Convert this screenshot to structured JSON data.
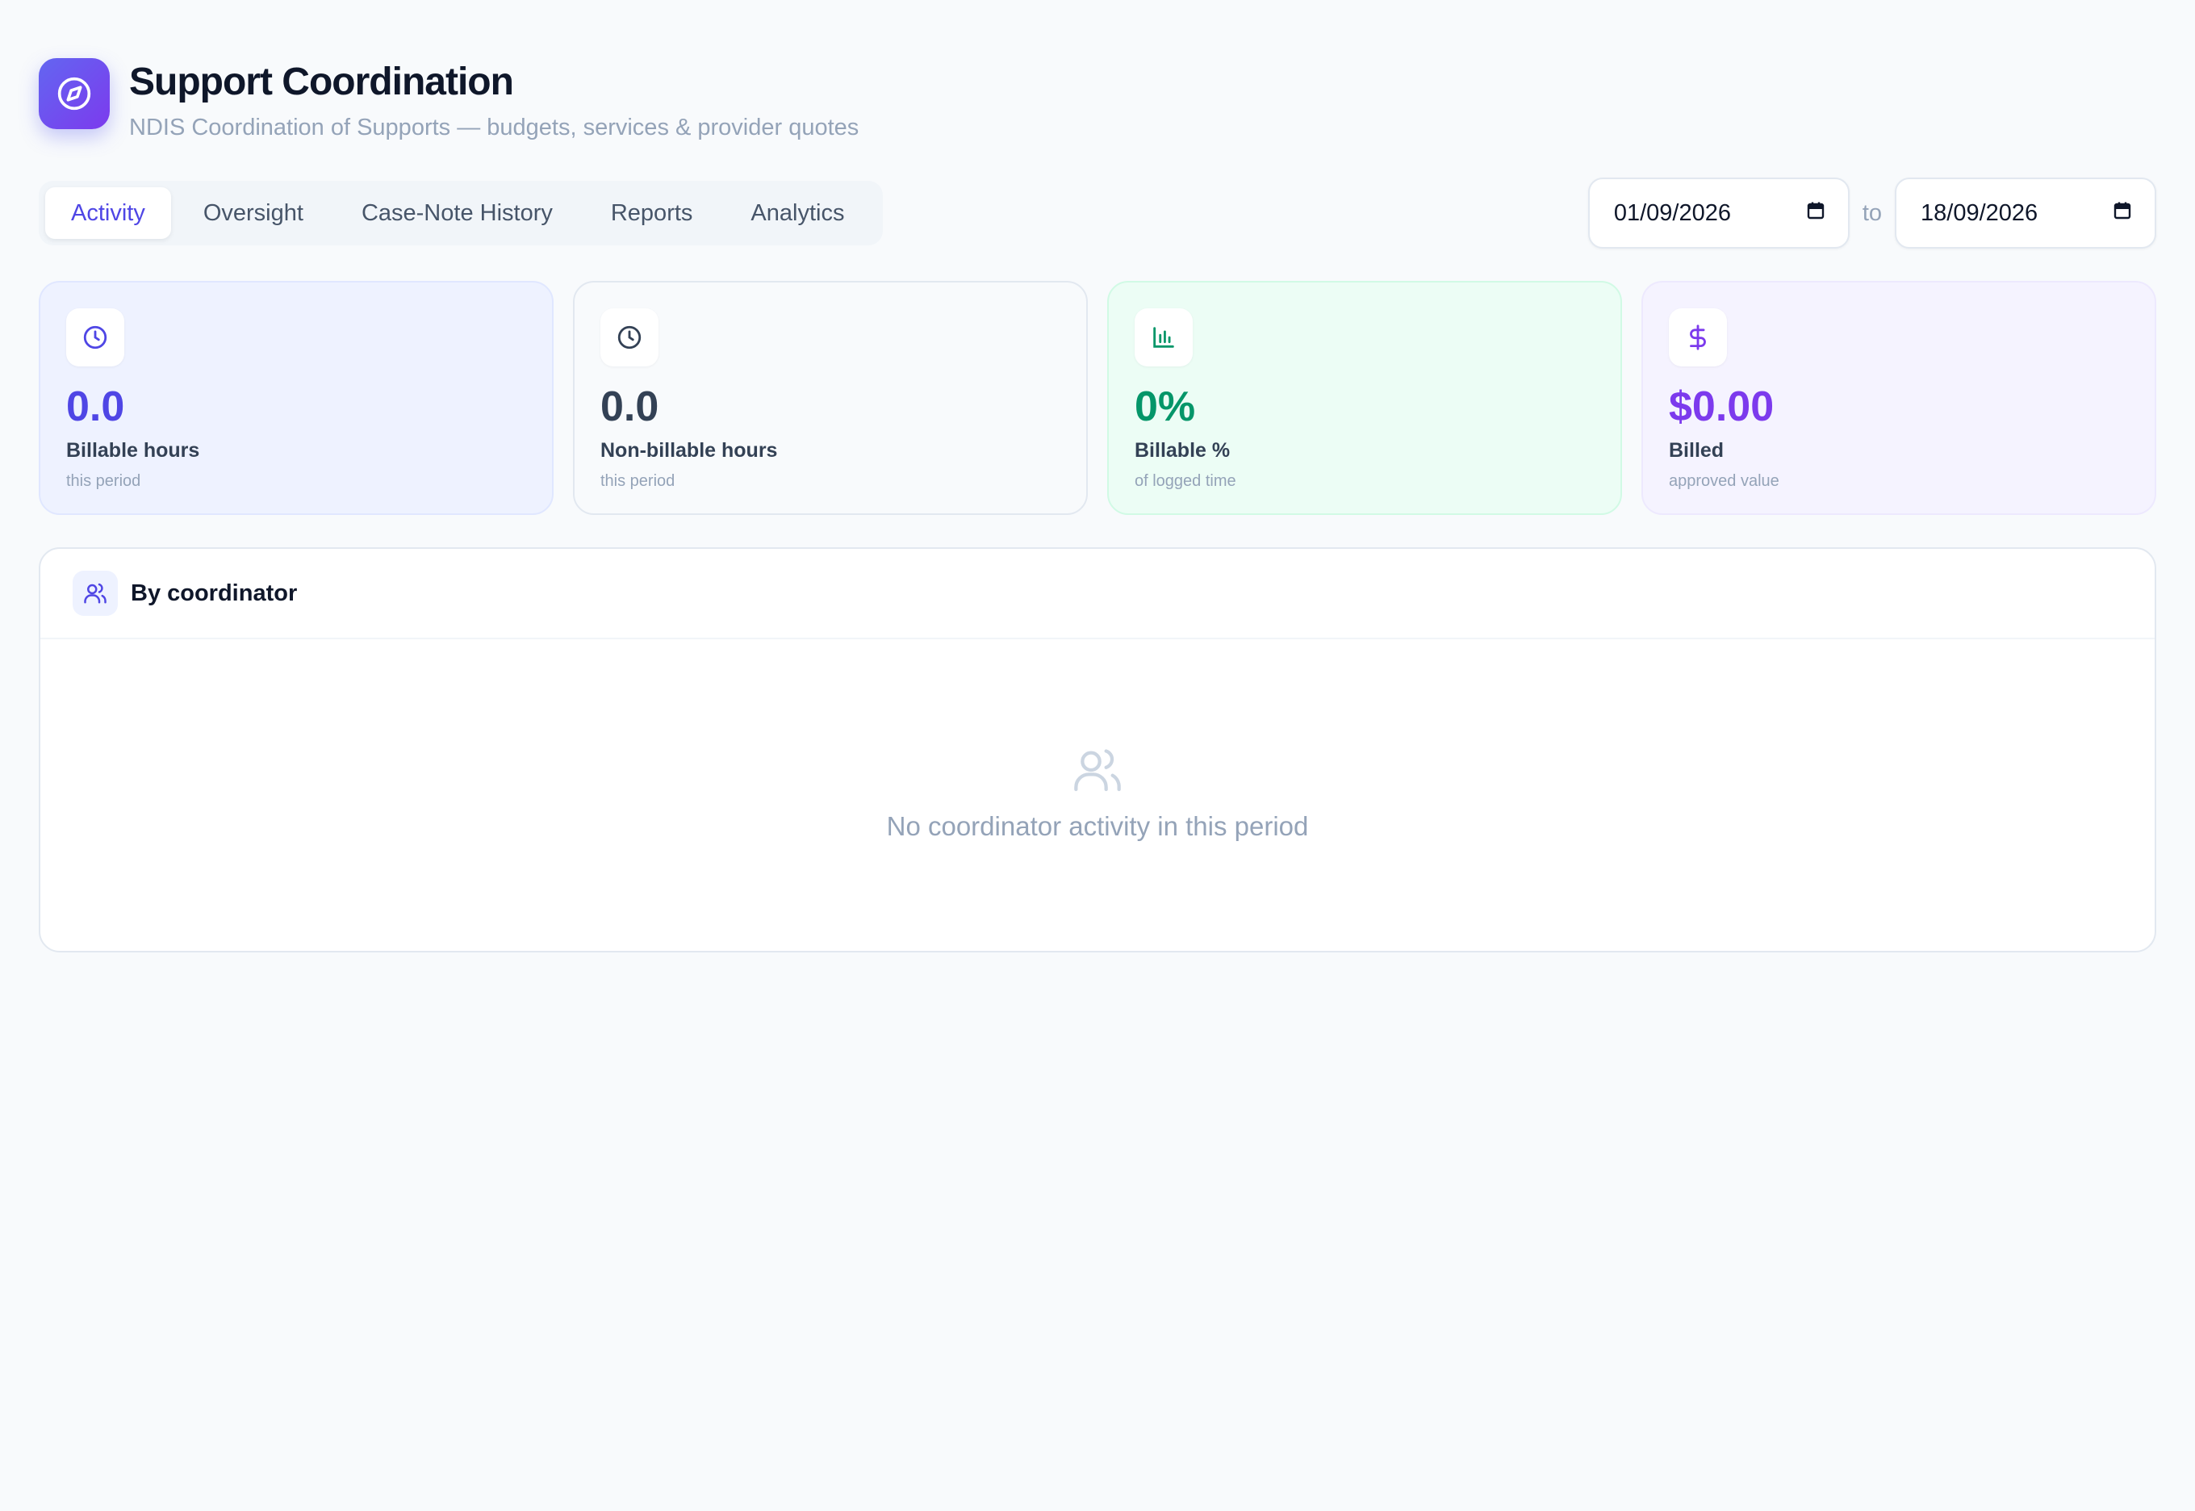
{
  "header": {
    "title": "Support Coordination",
    "subtitle": "NDIS Coordination of Supports — budgets, services & provider quotes",
    "icon": "compass-icon"
  },
  "tabs": [
    {
      "label": "Activity",
      "active": true
    },
    {
      "label": "Oversight",
      "active": false
    },
    {
      "label": "Case-Note History",
      "active": false
    },
    {
      "label": "Reports",
      "active": false
    },
    {
      "label": "Analytics",
      "active": false
    }
  ],
  "daterange": {
    "from": "01/09/2026",
    "separator": "to",
    "to": "18/09/2026"
  },
  "cards": [
    {
      "value": "0.0",
      "label": "Billable hours",
      "sub": "this period",
      "icon": "clock-icon",
      "color": "#4f46e5"
    },
    {
      "value": "0.0",
      "label": "Non-billable hours",
      "sub": "this period",
      "icon": "clock-icon",
      "color": "#334155"
    },
    {
      "value": "0%",
      "label": "Billable %",
      "sub": "of logged time",
      "icon": "bar-chart-icon",
      "color": "#059669"
    },
    {
      "value": "$0.00",
      "label": "Billed",
      "sub": "approved value",
      "icon": "dollar-icon",
      "color": "#7c3aed"
    }
  ],
  "panel": {
    "title": "By coordinator",
    "icon": "users-icon",
    "empty_message": "No coordinator activity in this period"
  },
  "colors": {
    "accent": "#4f46e5",
    "background": "#f8fafc",
    "muted_text": "#94a3b8"
  }
}
